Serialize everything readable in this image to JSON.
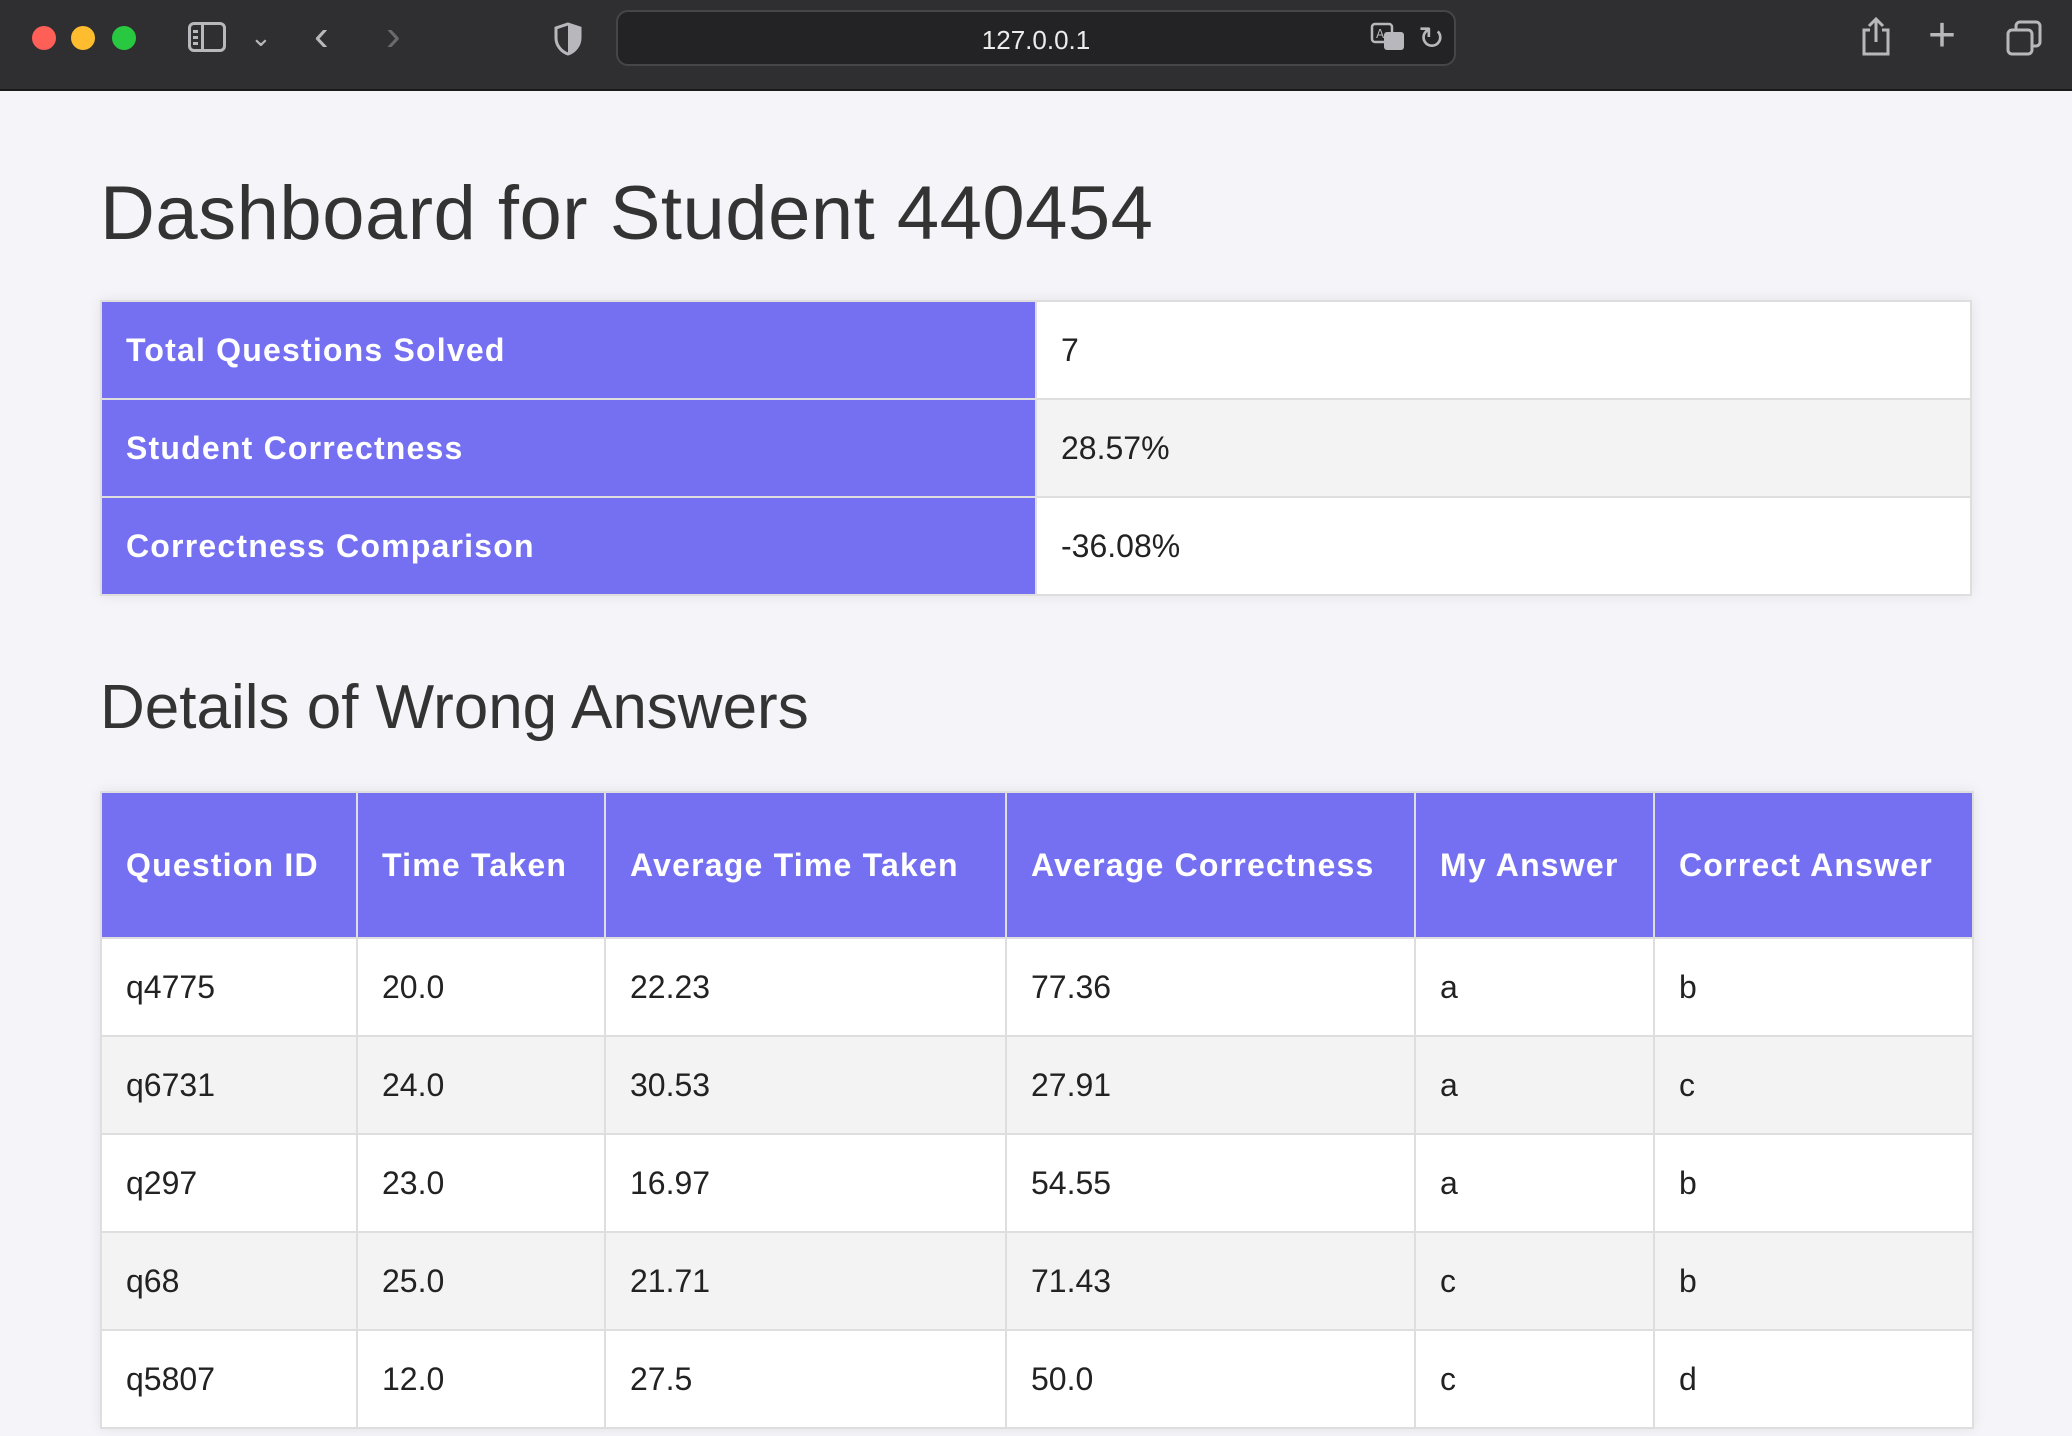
{
  "browser": {
    "url": "127.0.0.1"
  },
  "page": {
    "title": "Dashboard for Student 440454",
    "summary": [
      {
        "label": "Total Questions Solved",
        "value": "7"
      },
      {
        "label": "Student Correctness",
        "value": "28.57%"
      },
      {
        "label": "Correctness Comparison",
        "value": "-36.08%"
      }
    ],
    "section_title": "Details of Wrong Answers",
    "details": {
      "headers": [
        "Question ID",
        "Time Taken",
        "Average Time Taken",
        "Average Correctness",
        "My Answer",
        "Correct Answer"
      ],
      "rows": [
        [
          "q4775",
          "20.0",
          "22.23",
          "77.36",
          "a",
          "b"
        ],
        [
          "q6731",
          "24.0",
          "30.53",
          "27.91",
          "a",
          "c"
        ],
        [
          "q297",
          "23.0",
          "16.97",
          "54.55",
          "a",
          "b"
        ],
        [
          "q68",
          "25.0",
          "21.71",
          "71.43",
          "c",
          "b"
        ],
        [
          "q5807",
          "12.0",
          "27.5",
          "50.0",
          "c",
          "d"
        ]
      ]
    }
  },
  "colors": {
    "accent": "#7470f1",
    "background": "#f5f5f9",
    "chrome": "#2f2f31"
  }
}
